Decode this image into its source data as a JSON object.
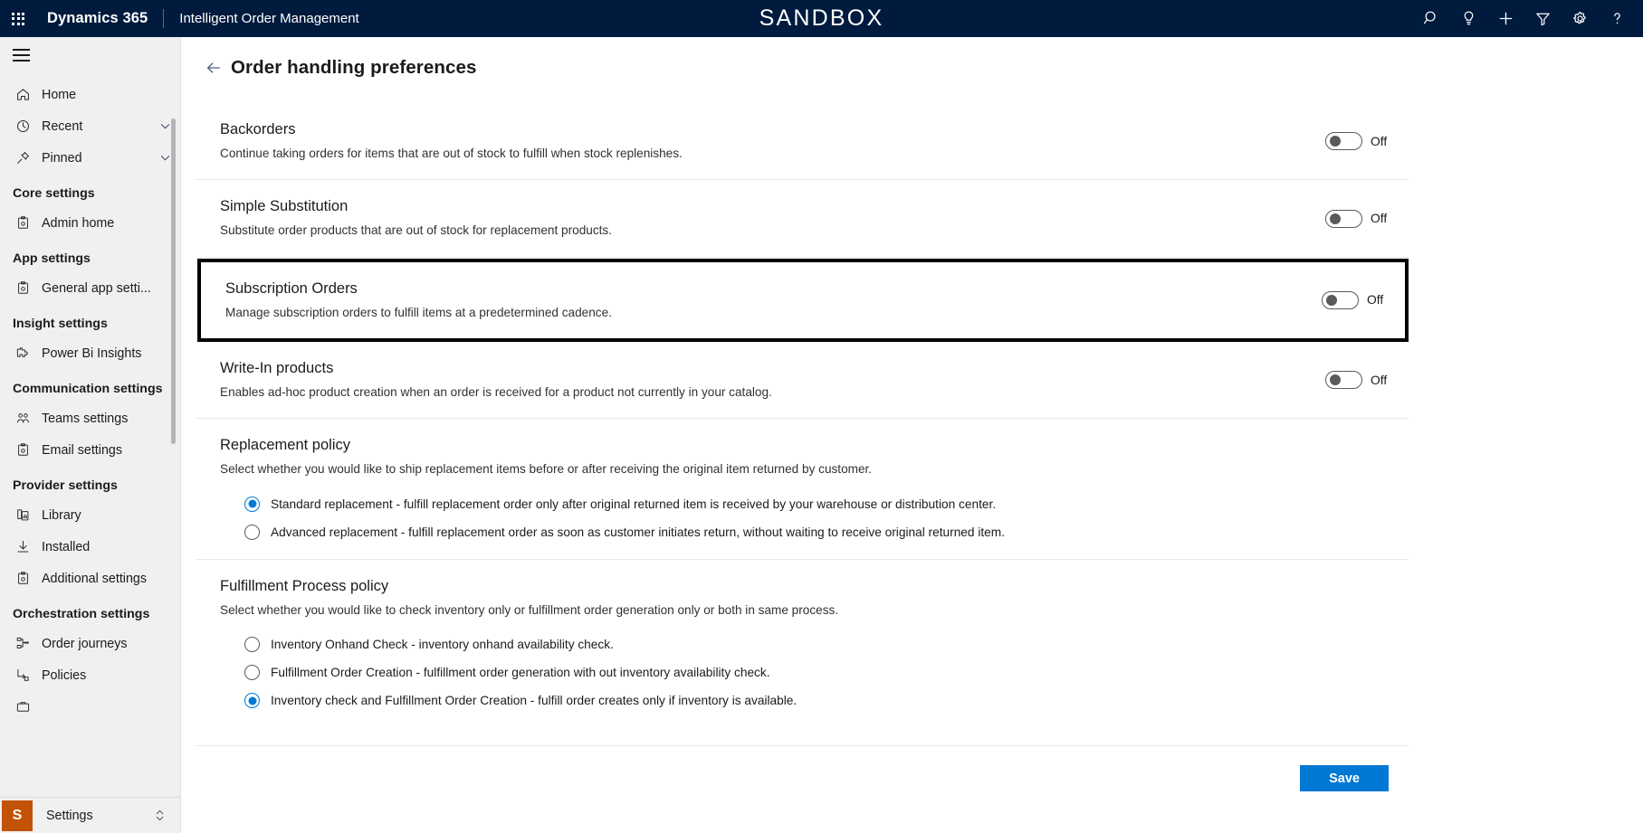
{
  "header": {
    "waffle_label": "app-launcher",
    "brand": "Dynamics 365",
    "app_name": "Intelligent Order Management",
    "environment_banner": "SANDBOX",
    "icons": [
      {
        "name": "search-icon",
        "label": "Search"
      },
      {
        "name": "lightbulb-icon",
        "label": "Insights"
      },
      {
        "name": "plus-icon",
        "label": "New"
      },
      {
        "name": "filter-icon",
        "label": "Filter"
      },
      {
        "name": "gear-icon",
        "label": "Settings"
      },
      {
        "name": "help-icon",
        "label": "Help"
      }
    ]
  },
  "sidebar": {
    "hamburger_label": "Expand navigation",
    "items": [
      {
        "label": "Home",
        "icon": "home-icon",
        "expandable": false
      },
      {
        "label": "Recent",
        "icon": "clock-icon",
        "expandable": true
      },
      {
        "label": "Pinned",
        "icon": "pin-icon",
        "expandable": true
      }
    ],
    "groups": [
      {
        "title": "Core settings",
        "items": [
          {
            "label": "Admin home",
            "icon": "clipboard-gear-icon"
          }
        ]
      },
      {
        "title": "App settings",
        "items": [
          {
            "label": "General app setti...",
            "icon": "clipboard-gear-icon"
          }
        ]
      },
      {
        "title": "Insight settings",
        "items": [
          {
            "label": "Power Bi Insights",
            "icon": "puzzle-icon"
          }
        ]
      },
      {
        "title": "Communication settings",
        "items": [
          {
            "label": "Teams settings",
            "icon": "people-icon"
          },
          {
            "label": "Email settings",
            "icon": "clipboard-gear-icon"
          }
        ]
      },
      {
        "title": "Provider settings",
        "items": [
          {
            "label": "Library",
            "icon": "library-icon"
          },
          {
            "label": "Installed",
            "icon": "download-icon"
          },
          {
            "label": "Additional settings",
            "icon": "clipboard-gear-icon"
          }
        ]
      },
      {
        "title": "Orchestration settings",
        "items": [
          {
            "label": "Order journeys",
            "icon": "hierarchy-icon"
          },
          {
            "label": "Policies",
            "icon": "flow-icon"
          }
        ]
      }
    ],
    "footer": {
      "badge": "S",
      "label": "Settings",
      "chevron": "up-down-chevron-icon"
    }
  },
  "page": {
    "back_label": "Back",
    "title": "Order handling preferences"
  },
  "toggles": [
    {
      "id": "backorders",
      "title": "Backorders",
      "description": "Continue taking orders for items that are out of stock to fulfill when stock replenishes.",
      "state_label": "Off",
      "on": false,
      "highlighted": false
    },
    {
      "id": "simple-substitution",
      "title": "Simple Substitution",
      "description": "Substitute order products that are out of stock for replacement products.",
      "state_label": "Off",
      "on": false,
      "highlighted": false
    },
    {
      "id": "subscription-orders",
      "title": "Subscription Orders",
      "description": "Manage subscription orders to fulfill items at a predetermined cadence.",
      "state_label": "Off",
      "on": false,
      "highlighted": true
    },
    {
      "id": "write-in-products",
      "title": "Write-In products",
      "description": "Enables ad-hoc product creation when an order is received for a product not currently in your catalog.",
      "state_label": "Off",
      "on": false,
      "highlighted": false
    }
  ],
  "replacement_policy": {
    "title": "Replacement policy",
    "description": "Select whether you would like to ship replacement items before or after receiving the original item returned by customer.",
    "options": [
      {
        "label": "Standard replacement - fulfill replacement order only after original returned item is received by your warehouse or distribution center.",
        "selected": true
      },
      {
        "label": "Advanced replacement - fulfill replacement order as soon as customer initiates return, without waiting to receive original returned item.",
        "selected": false
      }
    ]
  },
  "fulfillment_policy": {
    "title": "Fulfillment Process policy",
    "description": "Select whether you would like to check inventory only or fulfillment order generation only or both in same process.",
    "options": [
      {
        "label": "Inventory Onhand Check - inventory onhand availability check.",
        "selected": false
      },
      {
        "label": "Fulfillment Order Creation - fulfillment order generation with out inventory availability check.",
        "selected": false
      },
      {
        "label": "Inventory check and Fulfillment Order Creation - fulfill order creates only if inventory is available.",
        "selected": true
      }
    ]
  },
  "actions": {
    "save_label": "Save"
  },
  "colors": {
    "header_bg": "#001b3d",
    "accent": "#0078d4",
    "sidebar_bg": "#f0f0f0",
    "settings_badge": "#c25205",
    "highlight_border": "#000000"
  }
}
